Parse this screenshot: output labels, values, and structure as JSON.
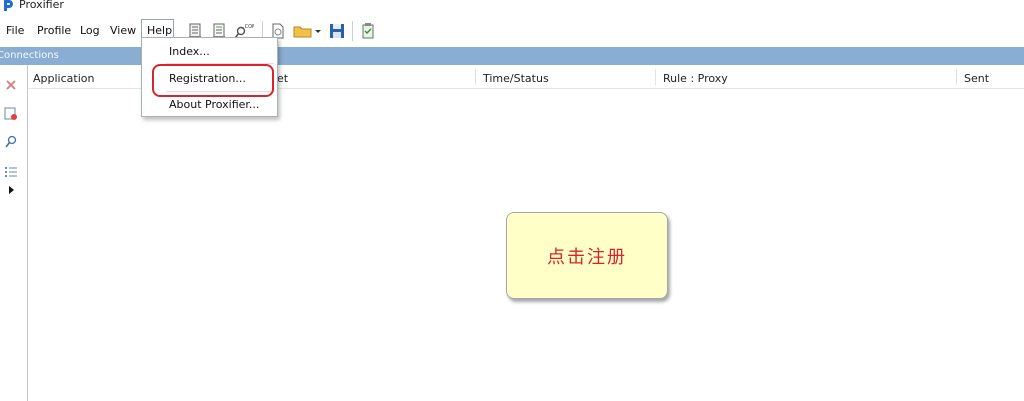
{
  "window": {
    "title": "Proxifier"
  },
  "menubar": {
    "items": [
      "File",
      "Profile",
      "Log",
      "View",
      "Help"
    ],
    "open_menu": "Help"
  },
  "toolbar": {
    "icons": [
      "proxy-servers-icon",
      "rules-icon",
      "name-resolution-icon",
      "new-profile-icon",
      "open-profile-icon",
      "save-profile-icon",
      "advanced-settings-icon"
    ]
  },
  "panel": {
    "title": "Connections"
  },
  "sidebar": {
    "icons": [
      "close-connection-icon",
      "new-rule-icon",
      "find-icon",
      "details-icon",
      "expand-arrow-icon"
    ]
  },
  "table": {
    "columns": [
      "Application",
      "et",
      "Time/Status",
      "Rule : Proxy",
      "Sent"
    ]
  },
  "help_menu": {
    "items": [
      "Index...",
      "Registration...",
      "About Proxifier..."
    ],
    "highlighted": "Registration..."
  },
  "annotation": {
    "text": "点击注册",
    "text_color": "#d4242e",
    "background": "#ffffc8"
  },
  "colors": {
    "panel_header": "#8aaed3",
    "highlight_outline": "#d9242e"
  }
}
